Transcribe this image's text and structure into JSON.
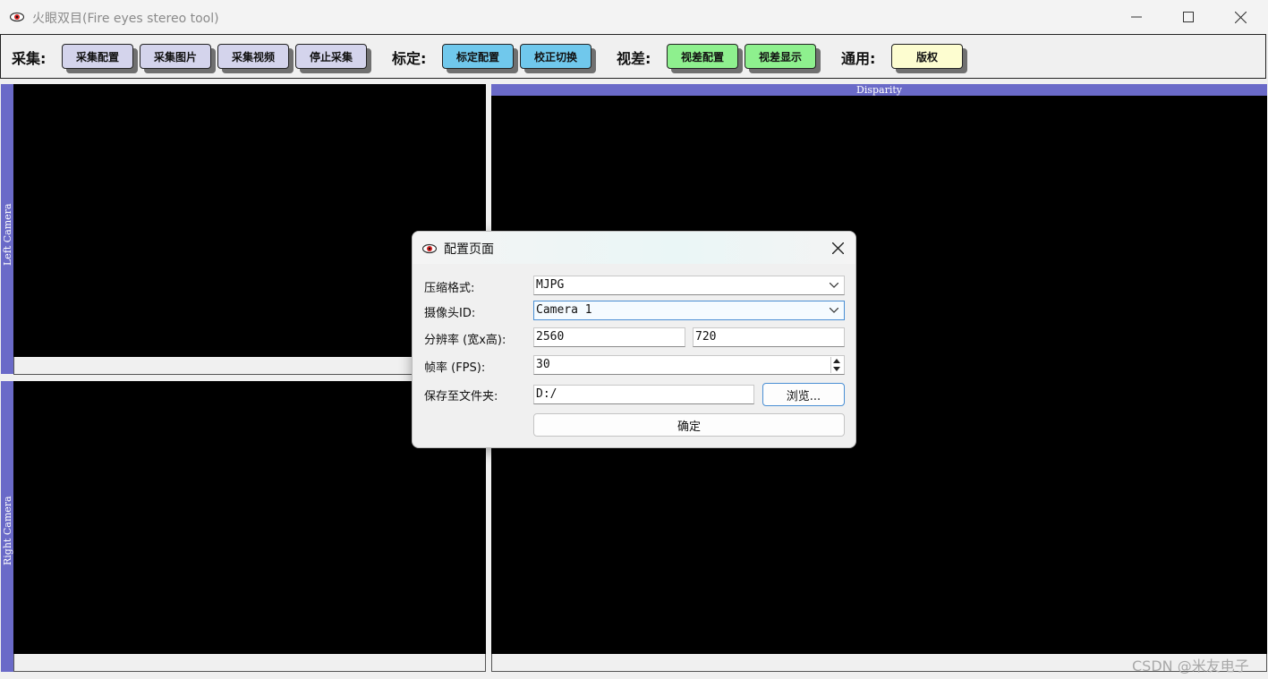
{
  "window": {
    "title": "火眼双目(Fire eyes stereo tool)",
    "icon": "eye-icon"
  },
  "toolbar": {
    "capture_label": "采集:",
    "capture_config": "采集配置",
    "capture_image": "采集图片",
    "capture_video": "采集视频",
    "stop_capture": "停止采集",
    "calib_label": "标定:",
    "calib_config": "标定配置",
    "rectify_switch": "校正切换",
    "disparity_label": "视差:",
    "disparity_config": "视差配置",
    "disparity_show": "视差显示",
    "general_label": "通用:",
    "copyright": "版权"
  },
  "panels": {
    "left_camera": "Left Camera",
    "right_camera": "Right Camera",
    "disparity": "Disparity"
  },
  "dialog": {
    "title": "配置页面",
    "format_label": "压缩格式:",
    "format_value": "MJPG",
    "camera_label": "摄像头ID:",
    "camera_value": "Camera 1",
    "resolution_label": "分辨率 (宽x高):",
    "width_value": "2560",
    "height_value": "720",
    "fps_label": "帧率 (FPS):",
    "fps_value": "30",
    "folder_label": "保存至文件夹:",
    "folder_value": "D:/",
    "browse": "浏览...",
    "confirm": "确定"
  },
  "watermark": "CSDN @米友电子",
  "colors": {
    "panel_tab": "#6a6ac8",
    "capture_buttons": "#d4d4ec",
    "calib_buttons": "#70c8ec",
    "disparity_buttons": "#8ef08e",
    "general_buttons": "#fdfdd0"
  }
}
